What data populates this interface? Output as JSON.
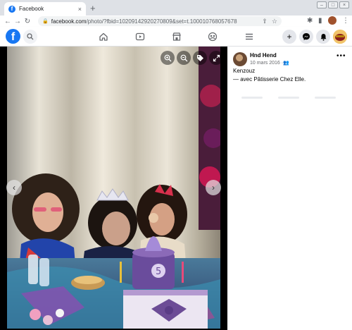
{
  "browser": {
    "tab_title": "Facebook",
    "tab_close": "×",
    "new_tab": "+",
    "url_host": "facebook.com",
    "url_path": "/photo/?fbid=10209142920270809&set=t.100010768057678"
  },
  "fb": {
    "logo": "f"
  },
  "post": {
    "author": "Hnd Hend",
    "date": "10 mars 2016",
    "more": "•••",
    "caption": "Kenzouz",
    "with_prefix": "— avec ",
    "tagged_page": "Pâtisserie Chez Elle",
    "tag_suffix": "."
  },
  "colors": {
    "brand": "#1877f2",
    "header_border": "#dddfe2",
    "viewer_bg": "#000000"
  }
}
